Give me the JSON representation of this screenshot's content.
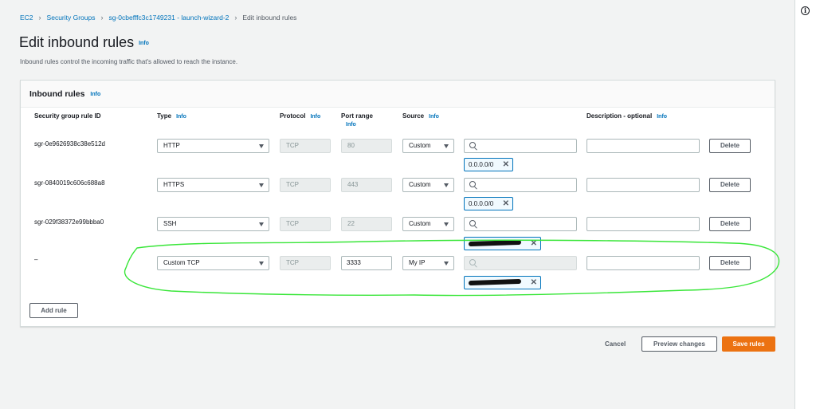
{
  "breadcrumbs": [
    {
      "label": "EC2"
    },
    {
      "label": "Security Groups"
    },
    {
      "label": "sg-0cbefffc3c1749231 - launch-wizard-2"
    },
    {
      "label": "Edit inbound rules"
    }
  ],
  "page": {
    "title": "Edit inbound rules",
    "info": "Info",
    "subtitle": "Inbound rules control the incoming traffic that's allowed to reach the instance."
  },
  "card": {
    "title": "Inbound rules",
    "info": "Info",
    "columns": {
      "rule_id": "Security group rule ID",
      "type": "Type",
      "protocol": "Protocol",
      "port_range": "Port range",
      "source": "Source",
      "description": "Description - optional",
      "info": "Info"
    }
  },
  "rules": [
    {
      "id": "sgr-0e9626938c38e512d",
      "type": "HTTP",
      "protocol": "TCP",
      "port": "80",
      "source": "Custom",
      "token": "0.0.0.0/0",
      "delete": "Delete"
    },
    {
      "id": "sgr-0840019c606c688a8",
      "type": "HTTPS",
      "protocol": "TCP",
      "port": "443",
      "source": "Custom",
      "token": "0.0.0.0/0",
      "delete": "Delete"
    },
    {
      "id": "sgr-029f38372e99bbba0",
      "type": "SSH",
      "protocol": "TCP",
      "port": "22",
      "source": "Custom",
      "token": "",
      "delete": "Delete"
    },
    {
      "id": "–",
      "type": "Custom TCP",
      "protocol": "TCP",
      "port": "3333",
      "source": "My IP",
      "token": "",
      "delete": "Delete"
    }
  ],
  "add_rule": "Add rule",
  "footer": {
    "cancel": "Cancel",
    "preview": "Preview changes",
    "save": "Save rules"
  },
  "colors": {
    "link": "#0073bb",
    "primary_button": "#ec7211",
    "annotation": "#39e639"
  },
  "icons": [
    "chevron-right-icon",
    "caret-down-icon",
    "search-icon",
    "close-icon",
    "info-circle-icon"
  ]
}
